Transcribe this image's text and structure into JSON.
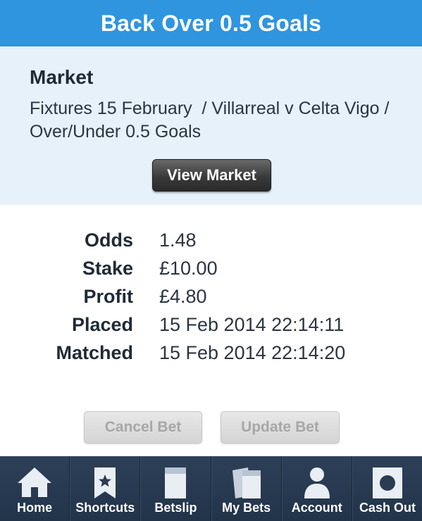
{
  "header": {
    "title": "Back Over 0.5 Goals"
  },
  "market": {
    "heading": "Market",
    "path": "Fixtures 15 February  / Villarreal v Celta Vigo / Over/Under 0.5 Goals",
    "view_button": "View Market"
  },
  "details": [
    {
      "label": "Odds",
      "value": "1.48"
    },
    {
      "label": "Stake",
      "value": "£10.00"
    },
    {
      "label": "Profit",
      "value": "£4.80"
    },
    {
      "label": "Placed",
      "value": "15 Feb 2014 22:14:11"
    },
    {
      "label": "Matched",
      "value": "15 Feb 2014 22:14:20"
    }
  ],
  "actions": {
    "cancel": "Cancel Bet",
    "update": "Update Bet"
  },
  "tabs": [
    {
      "label": "Home",
      "icon": "home-icon"
    },
    {
      "label": "Shortcuts",
      "icon": "bookmark-star-icon"
    },
    {
      "label": "Betslip",
      "icon": "betslip-icon"
    },
    {
      "label": "My Bets",
      "icon": "my-bets-icon"
    },
    {
      "label": "Account",
      "icon": "account-icon"
    },
    {
      "label": "Cash Out",
      "icon": "cash-out-icon"
    }
  ]
}
